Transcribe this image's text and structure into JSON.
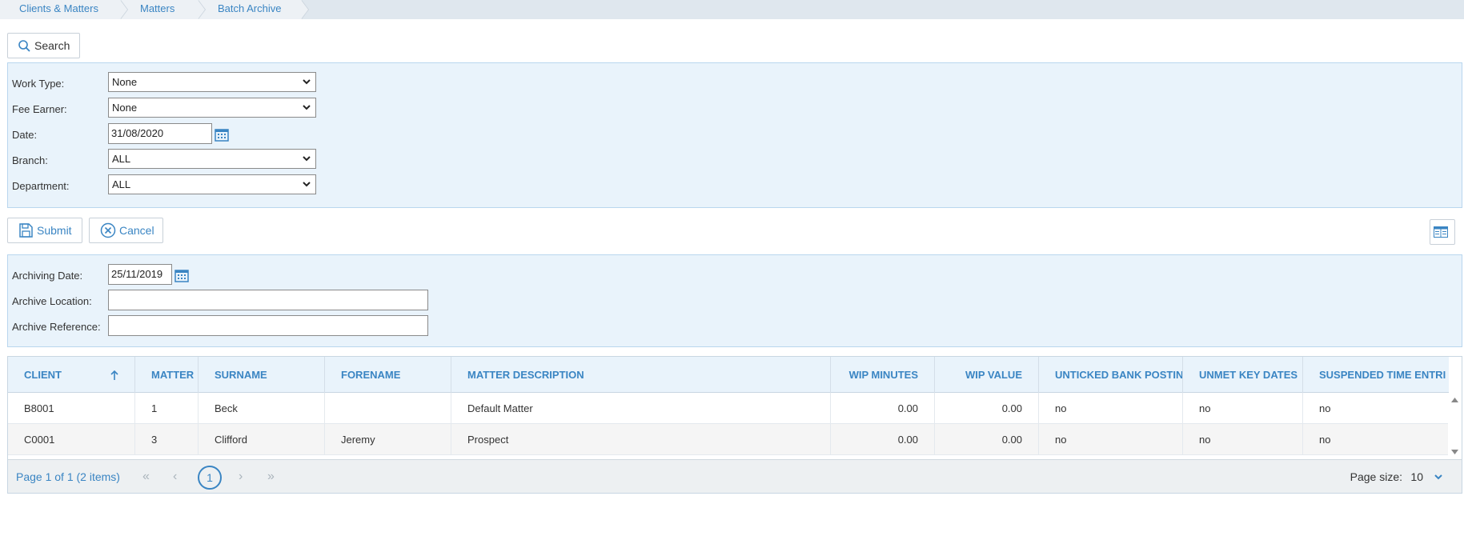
{
  "breadcrumb": [
    "Clients & Matters",
    "Matters",
    "Batch Archive"
  ],
  "search_button": "Search",
  "filters": {
    "work_type": {
      "label": "Work Type:",
      "value": "None"
    },
    "fee_earner": {
      "label": "Fee Earner:",
      "value": "None"
    },
    "date": {
      "label": "Date:",
      "value": "31/08/2020"
    },
    "branch": {
      "label": "Branch:",
      "value": "ALL"
    },
    "department": {
      "label": "Department:",
      "value": "ALL"
    }
  },
  "actions": {
    "submit": "Submit",
    "cancel": "Cancel"
  },
  "archive": {
    "date": {
      "label": "Archiving Date:",
      "value": "25/11/2019"
    },
    "location": {
      "label": "Archive Location:",
      "value": ""
    },
    "reference": {
      "label": "Archive Reference:",
      "value": ""
    }
  },
  "grid": {
    "columns": [
      "CLIENT",
      "MATTER",
      "SURNAME",
      "FORENAME",
      "MATTER DESCRIPTION",
      "WIP MINUTES",
      "WIP VALUE",
      "UNTICKED BANK POSTIN",
      "UNMET KEY DATES",
      "SUSPENDED TIME ENTRI"
    ],
    "sorted_column": "CLIENT",
    "rows": [
      [
        "B8001",
        "1",
        "Beck",
        "",
        "Default Matter",
        "0.00",
        "0.00",
        "no",
        "no",
        "no"
      ],
      [
        "C0001",
        "3",
        "Clifford",
        "Jeremy",
        "Prospect",
        "0.00",
        "0.00",
        "no",
        "no",
        "no"
      ]
    ]
  },
  "pager": {
    "info": "Page 1 of 1 (2 items)",
    "current_page": "1",
    "page_size_label": "Page size:",
    "page_size": "10"
  },
  "colors": {
    "accent": "#3a85c3",
    "panel": "#e9f3fb",
    "panel_border": "#b9d6ee"
  },
  "icons": [
    "search-icon",
    "save-icon",
    "close-circle-icon",
    "calendar-icon",
    "columns-icon",
    "sort-asc-icon",
    "chevron-down-icon"
  ]
}
